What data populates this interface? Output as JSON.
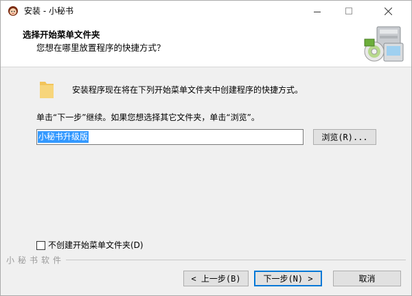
{
  "window": {
    "title": "安装 - 小秘书"
  },
  "header": {
    "title": "选择开始菜单文件夹",
    "subtitle": "您想在哪里放置程序的快捷方式？"
  },
  "content": {
    "intro": "安装程序现在将在下列开始菜单文件夹中创建程序的快捷方式。",
    "instruction": "单击“下一步”继续。如果您想选择其它文件夹，单击“浏览”。",
    "folder_value": "小秘书升级版",
    "browse_label": "浏览(R)...",
    "no_folder_checkbox": {
      "label": "不创建开始菜单文件夹(D)",
      "checked": false
    }
  },
  "footer": {
    "brand_watermark": "小秘书软件",
    "back_label": "< 上一步(B)",
    "next_label": "下一步(N) >",
    "cancel_label": "取消"
  },
  "icons": {
    "app": "app-character-icon",
    "folder": "folder-icon",
    "header_graphic": "installer-computer-graphic"
  }
}
